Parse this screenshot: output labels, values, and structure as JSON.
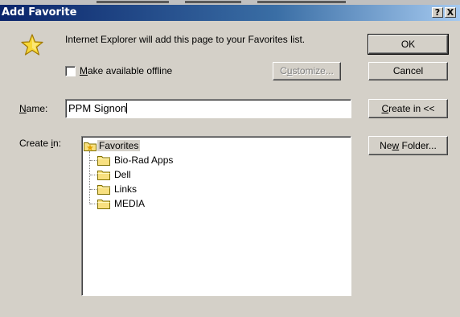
{
  "window": {
    "title": "Add Favorite",
    "help_label": "?",
    "close_label": "X"
  },
  "message": "Internet Explorer will add this page to your Favorites list.",
  "offline_checkbox": {
    "label_mnemonic": "M",
    "label_rest": "ake available offline",
    "checked": false
  },
  "buttons": {
    "customize": {
      "pre": "C",
      "mnemonic": "u",
      "post": "stomize..."
    },
    "ok": "OK",
    "cancel": "Cancel",
    "create_in": {
      "mnemonic": "C",
      "post": "reate in <<"
    },
    "new_folder": {
      "pre": "Ne",
      "mnemonic": "w",
      "post": " Folder..."
    }
  },
  "name_field": {
    "label_mnemonic": "N",
    "label_rest": "ame:",
    "value": "PPM Signon"
  },
  "create_in_label": {
    "pre": "Create ",
    "mnemonic": "i",
    "post": "n:"
  },
  "folder_tree": {
    "root": "Favorites",
    "children": [
      "Bio-Rad Apps",
      "Dell",
      "Links",
      "MEDIA"
    ]
  },
  "colors": {
    "face": "#d4d0c8",
    "title_start": "#0a246a",
    "title_end": "#a6caf0",
    "folder": "#f8e080"
  },
  "icons": {
    "favorite": "star-icon",
    "folder": "folder-icon"
  }
}
